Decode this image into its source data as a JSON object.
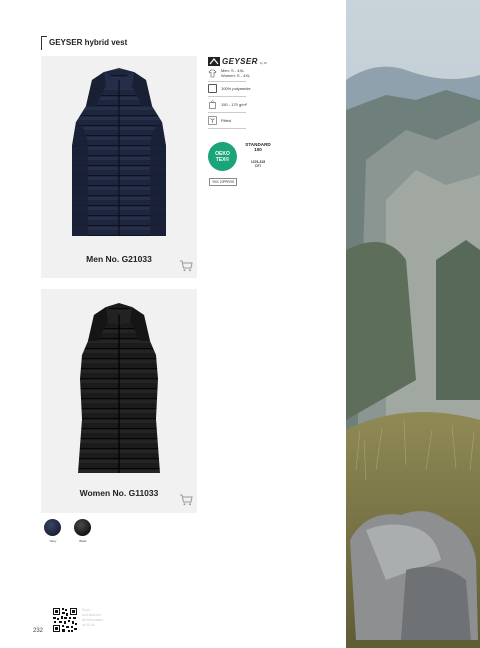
{
  "header": {
    "title": "GEYSER hybrid vest"
  },
  "products": {
    "men": {
      "label": "Men No. G21033"
    },
    "women": {
      "label": "Women No. G11033"
    }
  },
  "brand": {
    "name": "GEYSER",
    "sub": "by ID"
  },
  "specs": {
    "sizes_men": "Men: S - 4XL",
    "sizes_women": "Women: S - 4XL",
    "material": "100% polyamide",
    "weight": "150 - 170 g/m²",
    "fit": "Fitted"
  },
  "certification": {
    "badge_line1": "OEKO",
    "badge_line2": "TEX®",
    "standard_line1": "STANDARD",
    "standard_line2": "100",
    "code_line1": "1376-315",
    "code_line2": "DTI",
    "badge_color": "#1ba37a"
  },
  "feature_tag": "YKK ZIPPERS",
  "colors": [
    {
      "name": "Navy",
      "hex": "#1f2740"
    },
    {
      "name": "Black",
      "hex": "#181818"
    }
  ],
  "footer": {
    "page_number": "232",
    "qr_caption_lines": [
      "Scan",
      "and discover",
      "all information",
      "on ID.dk"
    ]
  },
  "icons": {
    "cart": "cart-icon",
    "sizes": "size-icon",
    "material": "fabric-icon",
    "weight": "weight-icon",
    "fit": "fit-icon"
  }
}
